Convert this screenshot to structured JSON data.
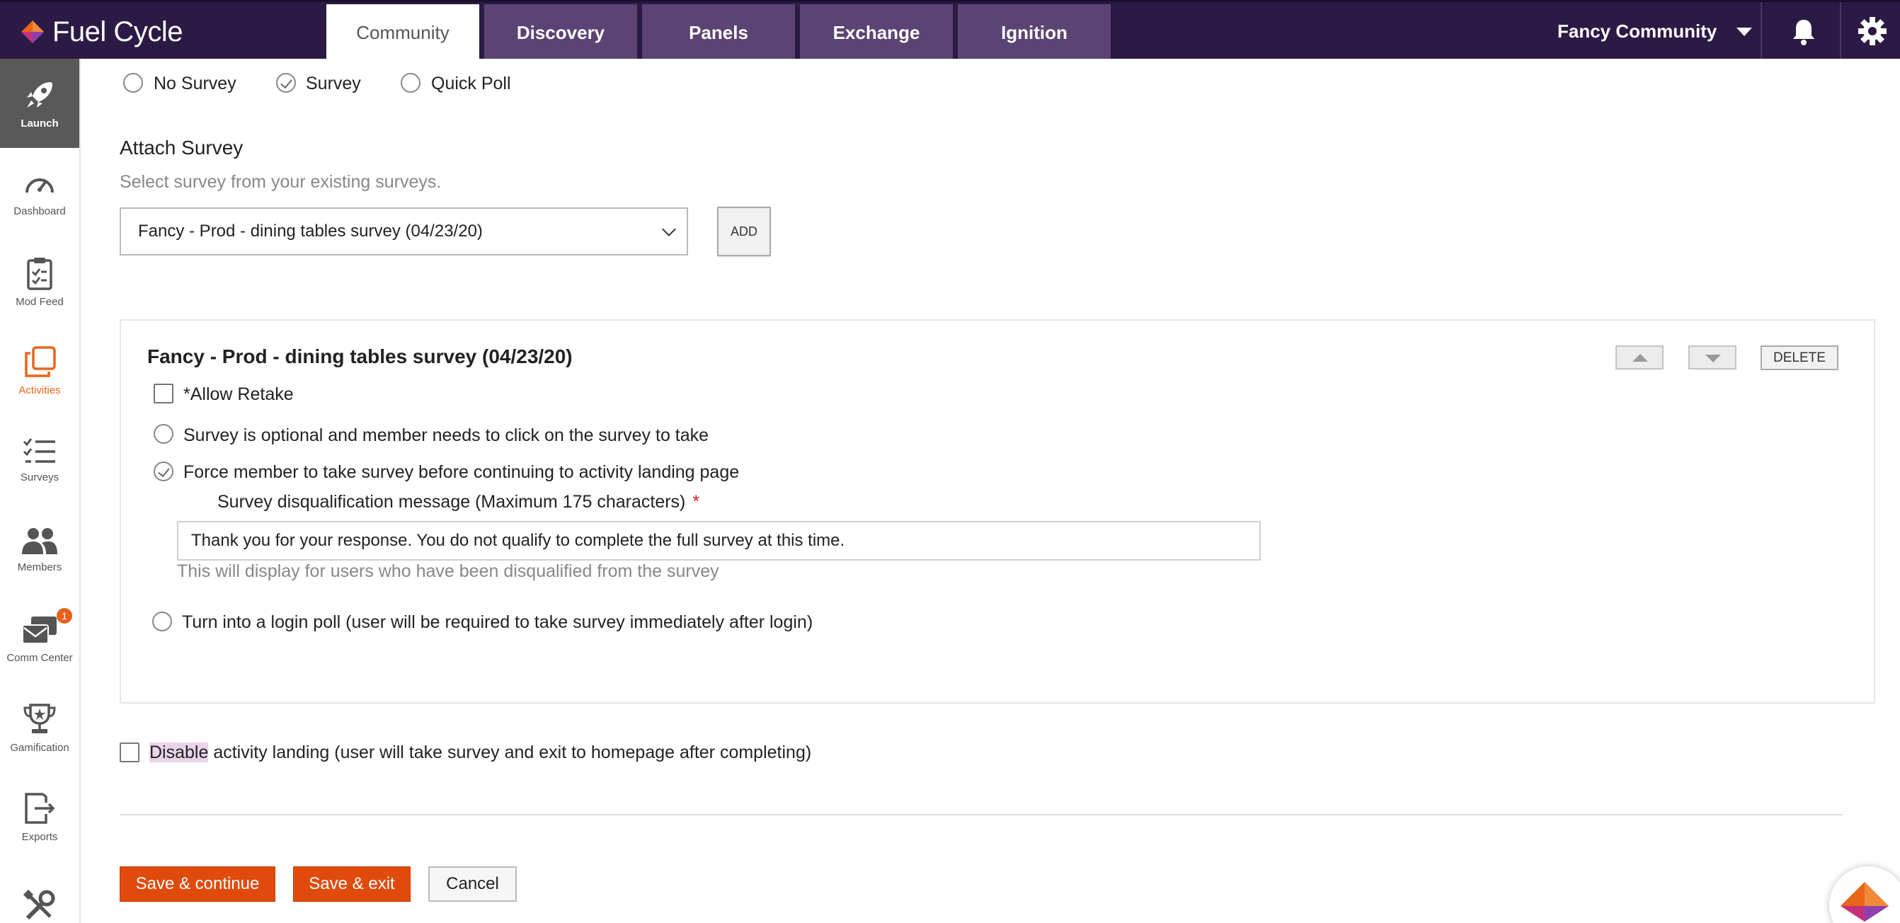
{
  "brand": {
    "name": "Fuel Cycle"
  },
  "nav": {
    "tabs": [
      "Community",
      "Discovery",
      "Panels",
      "Exchange",
      "Ignition"
    ],
    "community_name": "Fancy Community"
  },
  "sidebar": {
    "items": [
      {
        "label": "Launch",
        "icon": "rocket-icon"
      },
      {
        "label": "Dashboard",
        "icon": "gauge-icon"
      },
      {
        "label": "Mod Feed",
        "icon": "clipboard-icon"
      },
      {
        "label": "Activities",
        "icon": "activities-icon"
      },
      {
        "label": "Surveys",
        "icon": "checklist-icon"
      },
      {
        "label": "Members",
        "icon": "members-icon"
      },
      {
        "label": "Comm Center",
        "icon": "mail-icon"
      },
      {
        "label": "Gamification",
        "icon": "trophy-icon"
      },
      {
        "label": "Exports",
        "icon": "export-icon"
      },
      {
        "label": "",
        "icon": "tools-icon"
      }
    ],
    "comm_badge": "1"
  },
  "survey_type": {
    "options": [
      "No Survey",
      "Survey",
      "Quick Poll"
    ],
    "selected": "Survey"
  },
  "attach": {
    "title": "Attach Survey",
    "subtitle": "Select survey from your existing surveys.",
    "selected_survey": "Fancy - Prod - dining tables survey (04/23/20)",
    "add_label": "ADD"
  },
  "survey_panel": {
    "title": "Fancy - Prod - dining tables survey (04/23/20)",
    "delete_label": "DELETE",
    "allow_retake": "*Allow Retake",
    "option_optional": "Survey is optional and member needs to click on the survey to take",
    "option_force": "Force member to take survey before continuing to activity landing page",
    "dq_label": "Survey disqualification message (Maximum 175 characters)",
    "dq_required": "*",
    "dq_value": "Thank you for your response. You do not qualify to complete the full survey at this time.",
    "dq_help": "This will display for users who have been disqualified from the survey",
    "option_login_poll": "Turn into a login poll (user will be required to take survey immediately after login)"
  },
  "disable_landing": {
    "highlight": "Disable",
    "rest": " activity landing (user will take survey and exit to homepage after completing)"
  },
  "actions": {
    "save_continue": "Save & continue",
    "save_exit": "Save & exit",
    "cancel": "Cancel"
  },
  "colors": {
    "topbar": "#2b1a45",
    "tab": "#5b4373",
    "accent": "#e04b0b",
    "active_side": "#e8651a"
  }
}
